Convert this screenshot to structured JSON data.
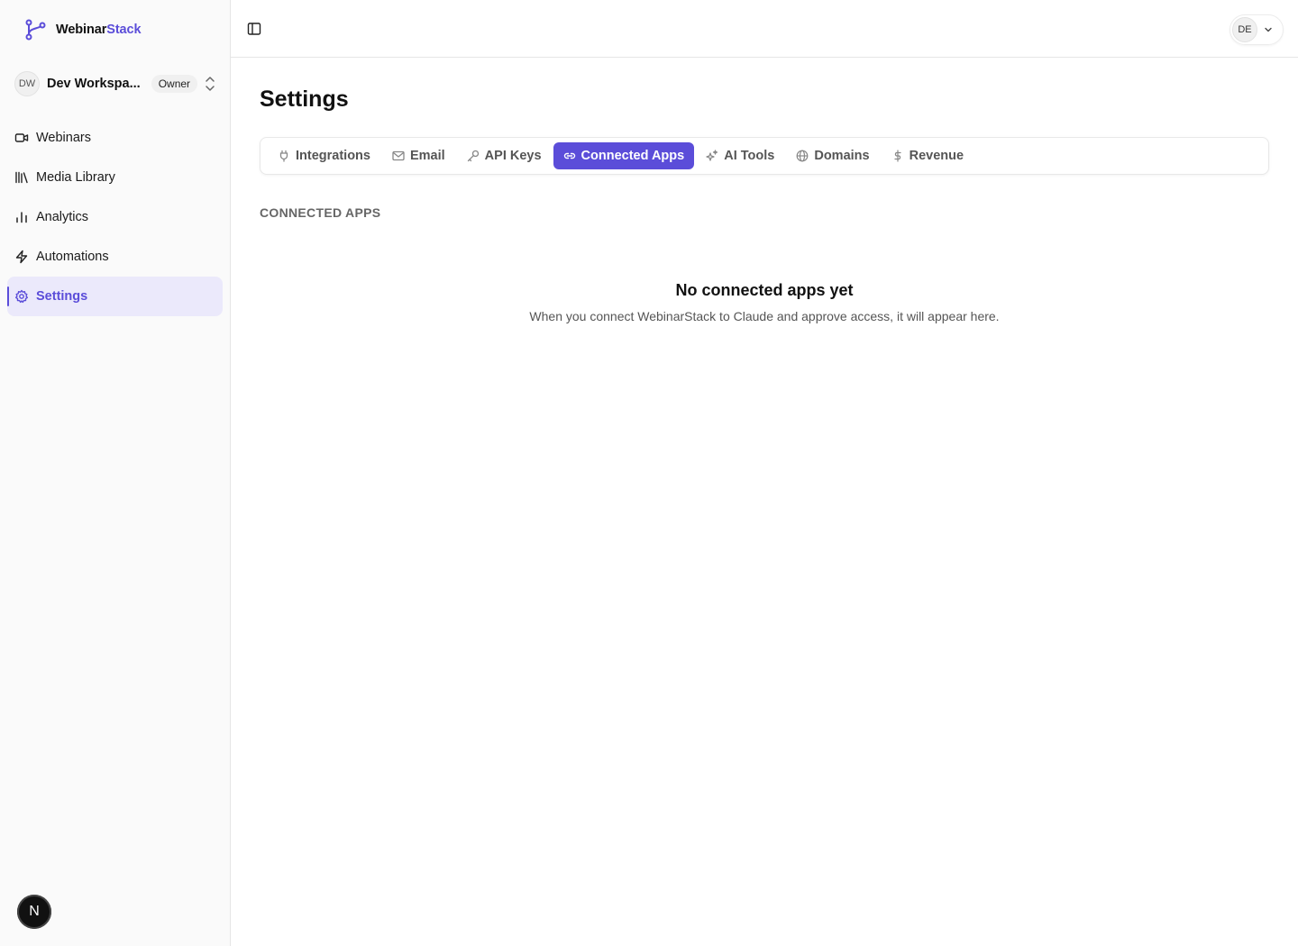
{
  "brand": {
    "name_part1": "Webinar",
    "name_part2": "Stack",
    "accent": "#5b4dd9"
  },
  "workspace": {
    "initials": "DW",
    "name": "Dev Workspa...",
    "role": "Owner"
  },
  "sidebar": {
    "items": [
      {
        "label": "Webinars",
        "icon": "video-icon",
        "active": false
      },
      {
        "label": "Media Library",
        "icon": "library-icon",
        "active": false
      },
      {
        "label": "Analytics",
        "icon": "bar-chart-icon",
        "active": false
      },
      {
        "label": "Automations",
        "icon": "zap-icon",
        "active": false
      },
      {
        "label": "Settings",
        "icon": "settings-icon",
        "active": true
      }
    ]
  },
  "user": {
    "initials": "DE"
  },
  "page": {
    "title": "Settings"
  },
  "tabs": [
    {
      "label": "Integrations",
      "icon": "plug-icon",
      "active": false
    },
    {
      "label": "Email",
      "icon": "mail-icon",
      "active": false
    },
    {
      "label": "API Keys",
      "icon": "key-icon",
      "active": false
    },
    {
      "label": "Connected Apps",
      "icon": "link-icon",
      "active": true
    },
    {
      "label": "AI Tools",
      "icon": "sparkles-icon",
      "active": false
    },
    {
      "label": "Domains",
      "icon": "globe-icon",
      "active": false
    },
    {
      "label": "Revenue",
      "icon": "dollar-icon",
      "active": false
    }
  ],
  "section": {
    "label": "CONNECTED APPS"
  },
  "empty_state": {
    "title": "No connected apps yet",
    "description": "When you connect WebinarStack to Claude and approve access, it will appear here."
  },
  "dev_badge": {
    "letter": "N"
  }
}
